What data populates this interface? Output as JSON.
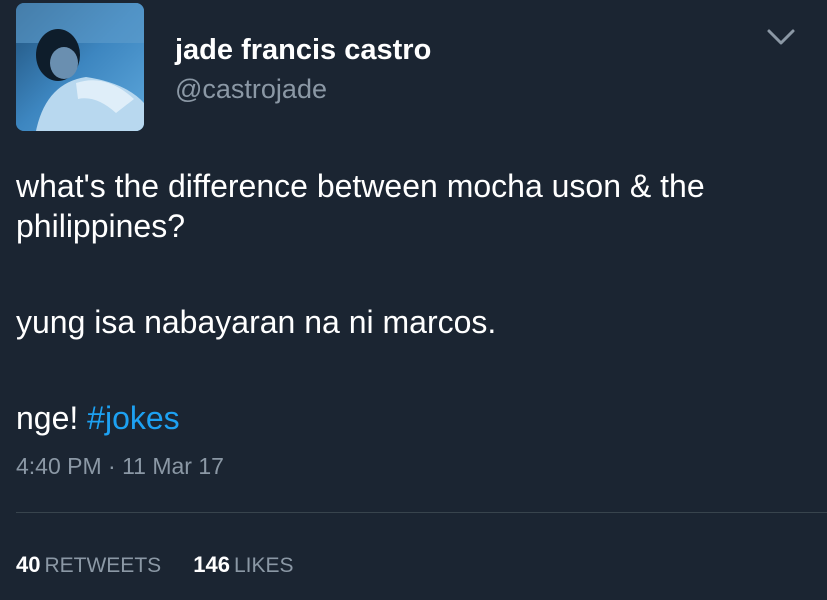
{
  "header": {
    "display_name": "jade francis castro",
    "handle": "@castrojade",
    "menu_icon": "chevron-down-icon"
  },
  "tweet": {
    "line1": "what's the difference between mocha uson & the philippines?",
    "line2": "yung isa nabayaran na ni marcos.",
    "line3_text": "nge! ",
    "hashtag": "#jokes",
    "timestamp": "4:40 PM · 11 Mar 17"
  },
  "stats": {
    "retweets_count": "40",
    "retweets_label": "RETWEETS",
    "likes_count": "146",
    "likes_label": "LIKES"
  },
  "colors": {
    "background": "#1b2532",
    "accent": "#1da1f2",
    "muted": "#8b98a5"
  }
}
